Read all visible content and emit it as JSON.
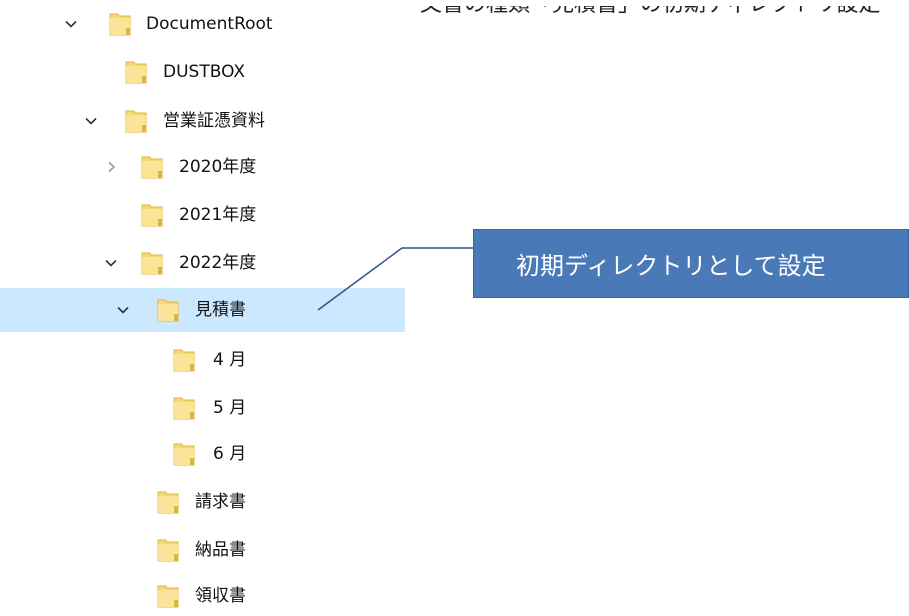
{
  "top_caption": "文書の種類「見積書」の初期ディレクトリ設定",
  "callout": "初期ディレクトリとして設定",
  "colors": {
    "selection": "#cce8ff",
    "callout_bg": "#4a79b8",
    "folder": "#f8d775"
  },
  "tree": [
    {
      "label": "DocumentRoot",
      "expander": "expanded"
    },
    {
      "label": "DUSTBOX",
      "expander": "none"
    },
    {
      "label": "営業証憑資料",
      "expander": "expanded"
    },
    {
      "label": "2020年度",
      "expander": "collapsed"
    },
    {
      "label": "2021年度",
      "expander": "none"
    },
    {
      "label": "2022年度",
      "expander": "expanded"
    },
    {
      "label": "見積書",
      "expander": "expanded",
      "selected": true
    },
    {
      "label": "4 月",
      "expander": "none"
    },
    {
      "label": "5 月",
      "expander": "none"
    },
    {
      "label": "6 月",
      "expander": "none"
    },
    {
      "label": "請求書",
      "expander": "none"
    },
    {
      "label": "納品書",
      "expander": "none"
    },
    {
      "label": "領収書",
      "expander": "none"
    }
  ]
}
